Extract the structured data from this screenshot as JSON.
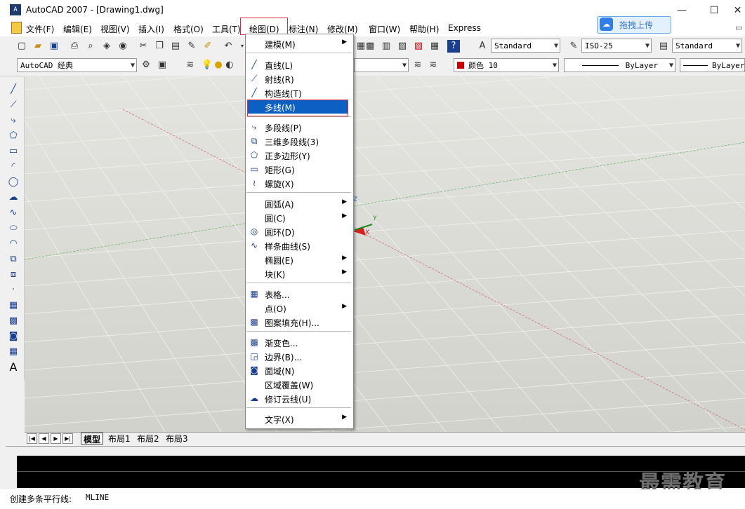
{
  "window": {
    "title": "AutoCAD 2007 - [Drawing1.dwg]",
    "minimize": "—",
    "maximize": "☐",
    "close": "✕"
  },
  "menubar": {
    "items": [
      "文件(F)",
      "编辑(E)",
      "视图(V)",
      "插入(I)",
      "格式(O)",
      "工具(T)",
      "绘图(D)",
      "标注(N)",
      "修改(M)",
      "窗口(W)",
      "帮助(H)",
      "Express"
    ]
  },
  "upload": {
    "label": "拖拽上传"
  },
  "toolbar1": {
    "text_style": "Standard",
    "dim_style": "ISO-25",
    "table_style": "Standard"
  },
  "toolbar2": {
    "workspace": "AutoCAD 经典",
    "color": "颜色 10",
    "linetype": "ByLayer",
    "lineweight": "ByLayer"
  },
  "tabs": {
    "model": "模型",
    "layout1": "布局1",
    "layout2": "布局2",
    "layout3": "布局3"
  },
  "status": {
    "prompt": "创建多条平行线:",
    "command": "MLINE"
  },
  "watermark": "最需教育",
  "colors": {
    "selection": "#0c5fc3",
    "highlight_border": "#e0293a",
    "color_swatch": "#cc0000"
  },
  "draw_menu": {
    "items": [
      {
        "label": "建模(M)",
        "icon": "",
        "submenu": true
      },
      {
        "label": "直线(L)",
        "icon": "line-icon"
      },
      {
        "label": "射线(R)",
        "icon": "ray-icon"
      },
      {
        "label": "构造线(T)",
        "icon": "xline-icon"
      },
      {
        "label": "多线(M)",
        "icon": "",
        "selected": true
      },
      {
        "label": "多段线(P)",
        "icon": "polyline-icon"
      },
      {
        "label": "三维多段线(3)",
        "icon": "3dpoly-icon"
      },
      {
        "label": "正多边形(Y)",
        "icon": "polygon-icon"
      },
      {
        "label": "矩形(G)",
        "icon": "rectangle-icon"
      },
      {
        "label": "螺旋(X)",
        "icon": "helix-icon"
      },
      {
        "label": "圆弧(A)",
        "icon": "",
        "submenu": true
      },
      {
        "label": "圆(C)",
        "icon": "",
        "submenu": true
      },
      {
        "label": "圆环(D)",
        "icon": "donut-icon"
      },
      {
        "label": "样条曲线(S)",
        "icon": "spline-icon"
      },
      {
        "label": "椭圆(E)",
        "icon": "",
        "submenu": true
      },
      {
        "label": "块(K)",
        "icon": "",
        "submenu": true
      },
      {
        "label": "表格...",
        "icon": "table-icon"
      },
      {
        "label": "点(O)",
        "icon": "",
        "submenu": true
      },
      {
        "label": "图案填充(H)...",
        "icon": "hatch-icon"
      },
      {
        "label": "渐变色...",
        "icon": "gradient-icon"
      },
      {
        "label": "边界(B)...",
        "icon": "boundary-icon"
      },
      {
        "label": "面域(N)",
        "icon": "region-icon"
      },
      {
        "label": "区域覆盖(W)",
        "icon": ""
      },
      {
        "label": "修订云线(U)",
        "icon": "revcloud-icon"
      },
      {
        "label": "文字(X)",
        "icon": "",
        "submenu": true
      }
    ]
  }
}
